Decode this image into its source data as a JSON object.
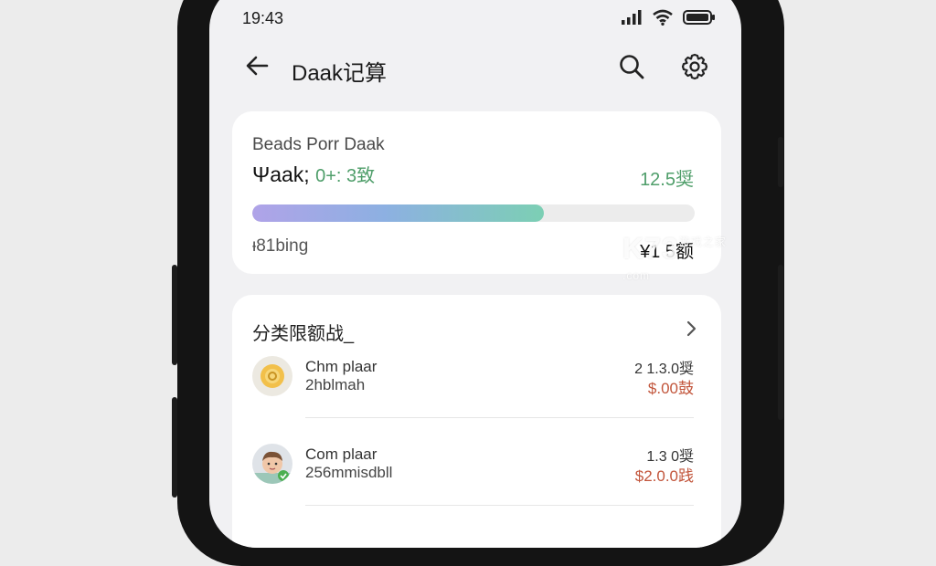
{
  "status_bar": {
    "time": "19:43"
  },
  "app_bar": {
    "title": "Daak记算"
  },
  "budget_card": {
    "label": "Beads Porr Daak",
    "amount_main": "Ψaak;",
    "amount_accent": "0+: 3致",
    "right_value": "12.5奨",
    "progress_percent": 66,
    "footer_left": "ᵻ81bing",
    "footer_right": "¥1 5额"
  },
  "category_card": {
    "title": "分类限额战_",
    "items": [
      {
        "name": "Chm plaar",
        "sub": "2hblmah",
        "value_top": "2 1.3.0奨",
        "value_bottom": "$.00鼓"
      },
      {
        "name": "Com plaar",
        "sub": "256mmisdbll",
        "value_top": "1.3 0奨",
        "value_bottom": "$2.0.0践"
      }
    ]
  },
  "watermark": {
    "text": "K73",
    "sub": "游戏之家 .com"
  },
  "colors": {
    "accent_green": "#4f9e6a",
    "accent_red": "#c2553b",
    "background": "#f1f1f3"
  }
}
